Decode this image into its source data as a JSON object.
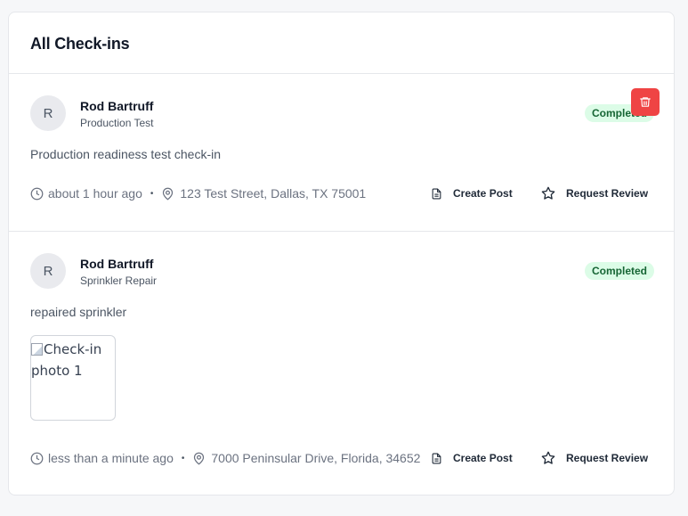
{
  "header": {
    "title": "All Check-ins"
  },
  "checkins": [
    {
      "avatar_initial": "R",
      "name": "Rod Bartruff",
      "service": "Production Test",
      "status": "Completed",
      "description": "Production readiness test check-in",
      "time": "about 1 hour ago",
      "separator": "•",
      "address": "123 Test Street, Dallas, TX 75001",
      "create_post_label": "Create Post",
      "request_review_label": "Request Review",
      "delete_icon": "trash-icon"
    },
    {
      "avatar_initial": "R",
      "name": "Rod Bartruff",
      "service": "Sprinkler Repair",
      "status": "Completed",
      "description": "repaired sprinkler",
      "photo_alt": "Check-in photo 1",
      "time": "less than a minute ago",
      "separator": "•",
      "address": "7000 Peninsular Drive, Florida, 34652",
      "create_post_label": "Create Post",
      "request_review_label": "Request Review"
    }
  ],
  "colors": {
    "badge_bg": "#dcfce7",
    "badge_text": "#166534",
    "delete_bg": "#ef4444",
    "muted_text": "#6b7280"
  }
}
